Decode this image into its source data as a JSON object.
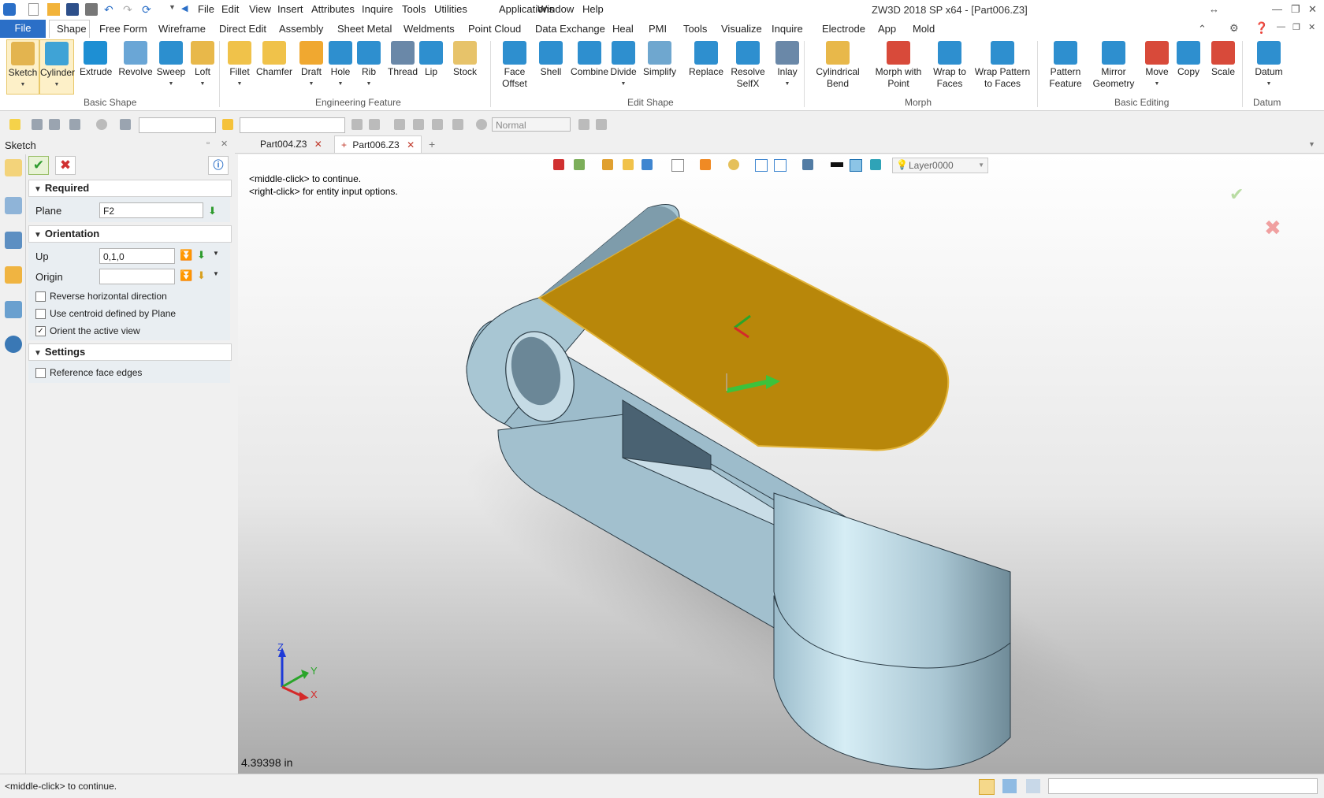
{
  "app": {
    "title": "ZW3D 2018 SP x64 - [Part006.Z3]"
  },
  "menubar": {
    "items": [
      "File",
      "Edit",
      "View",
      "Insert",
      "Attributes",
      "Inquire",
      "Tools",
      "Utilities",
      "Applications",
      "Window",
      "Help"
    ]
  },
  "ribbon_tabs": {
    "file": "File",
    "items": [
      "Shape",
      "Free Form",
      "Wireframe",
      "Direct Edit",
      "Assembly",
      "Sheet Metal",
      "Weldments",
      "Point Cloud",
      "Data Exchange",
      "Heal",
      "PMI",
      "Tools",
      "Visualize",
      "Inquire",
      "Electrode",
      "App",
      "Mold"
    ],
    "active": "Shape"
  },
  "ribbon": {
    "groups": [
      {
        "label": "Basic Shape",
        "tools": [
          {
            "label": "Sketch",
            "dd": true
          },
          {
            "label": "Cylinder",
            "dd": true
          },
          {
            "label": "Extrude"
          },
          {
            "label": "Revolve"
          },
          {
            "label": "Sweep",
            "dd": true
          },
          {
            "label": "Loft",
            "dd": true
          }
        ]
      },
      {
        "label": "Engineering Feature",
        "tools": [
          {
            "label": "Fillet",
            "dd": true
          },
          {
            "label": "Chamfer"
          },
          {
            "label": "Draft",
            "dd": true
          },
          {
            "label": "Hole",
            "dd": true
          },
          {
            "label": "Rib",
            "dd": true
          },
          {
            "label": "Thread"
          },
          {
            "label": "Lip"
          },
          {
            "label": "Stock"
          }
        ]
      },
      {
        "label": "Edit Shape",
        "tools": [
          {
            "label": "Face\nOffset"
          },
          {
            "label": "Shell"
          },
          {
            "label": "Combine"
          },
          {
            "label": "Divide",
            "dd": true
          },
          {
            "label": "Simplify"
          },
          {
            "label": "Replace"
          },
          {
            "label": "Resolve\nSelfX"
          },
          {
            "label": "Inlay",
            "dd": true
          }
        ]
      },
      {
        "label": "Morph",
        "tools": [
          {
            "label": "Cylindrical\nBend"
          },
          {
            "label": "Morph with\nPoint"
          },
          {
            "label": "Wrap to\nFaces"
          },
          {
            "label": "Wrap Pattern\nto Faces"
          }
        ]
      },
      {
        "label": "Basic Editing",
        "tools": [
          {
            "label": "Pattern\nFeature"
          },
          {
            "label": "Mirror\nGeometry"
          },
          {
            "label": "Move",
            "dd": true
          },
          {
            "label": "Copy"
          },
          {
            "label": "Scale"
          }
        ]
      },
      {
        "label": "Datum",
        "tools": [
          {
            "label": "Datum",
            "dd": true
          }
        ]
      }
    ]
  },
  "toolbar": {
    "render_mode": "Normal"
  },
  "document_tabs": [
    "Part004.Z3",
    "Part006.Z3"
  ],
  "viewport_toolbar": {
    "layer": "Layer0000"
  },
  "sketch_panel": {
    "title": "Sketch",
    "required_label": "Required",
    "plane_label": "Plane",
    "plane_value": "F2",
    "orientation_label": "Orientation",
    "up_label": "Up",
    "up_value": "0,1,0",
    "origin_label": "Origin",
    "origin_value": "",
    "checkboxes": [
      {
        "label": "Reverse horizontal direction",
        "checked": false
      },
      {
        "label": "Use centroid defined by Plane",
        "checked": false
      },
      {
        "label": "Orient the active view",
        "checked": true
      }
    ],
    "settings_label": "Settings",
    "settings_checkboxes": [
      {
        "label": "Reference face edges",
        "checked": false
      }
    ]
  },
  "viewport": {
    "hint_1": "<middle-click> to continue.",
    "hint_2": "<right-click> for entity input options.",
    "measure": "4.39398 in",
    "axis_x": "X",
    "axis_y": "Y",
    "axis_z": "Z",
    "selected_face_color": "#b8870a",
    "body_color": "#9fbccb"
  },
  "statusbar": {
    "text": "<middle-click> to continue."
  }
}
